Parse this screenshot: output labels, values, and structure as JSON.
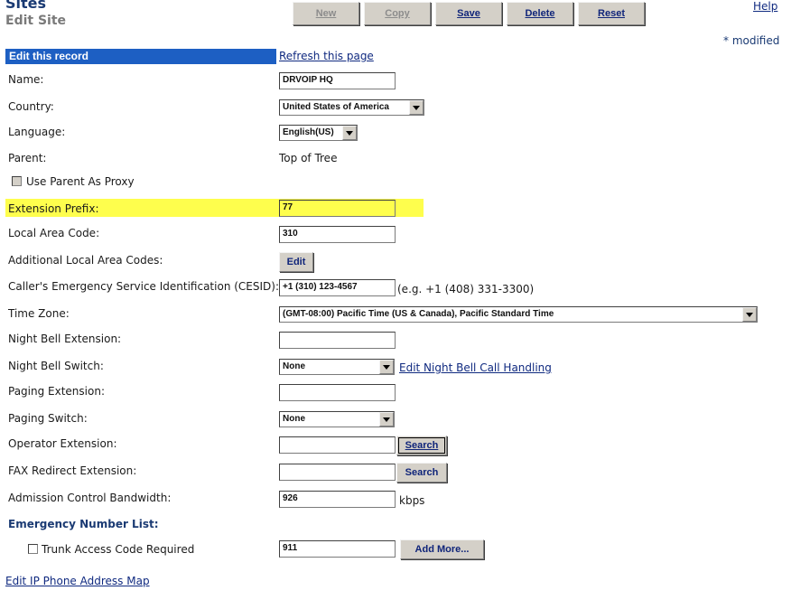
{
  "header": {
    "title": "Sites",
    "subtitle": "Edit Site",
    "help": "Help",
    "modified_note": "* modified"
  },
  "toolbar": {
    "new": "New",
    "copy": "Copy",
    "save": "Save",
    "delete": "Delete",
    "reset": "Reset"
  },
  "section": {
    "title": "Edit this record",
    "refresh": "Refresh this page"
  },
  "fields": {
    "name": {
      "label": "Name:",
      "value": "DRVOIP HQ"
    },
    "country": {
      "label": "Country:",
      "value": "United States of America"
    },
    "language": {
      "label": "Language:",
      "value": "English(US)"
    },
    "parent": {
      "label": "Parent:",
      "value": "Top of Tree"
    },
    "use_parent_proxy": {
      "label": "Use Parent As Proxy",
      "checked": false
    },
    "extension_prefix": {
      "label": "Extension Prefix:",
      "value": "77"
    },
    "local_area_code": {
      "label": "Local Area Code:",
      "value": "310"
    },
    "additional_area_codes": {
      "label": "Additional Local Area Codes:",
      "button": "Edit"
    },
    "cesid": {
      "label": "Caller's Emergency Service Identification (CESID):",
      "value": "+1 (310) 123-4567",
      "hint": "(e.g. +1 (408) 331-3300)"
    },
    "time_zone": {
      "label": "Time Zone:",
      "value": "(GMT-08:00) Pacific Time (US & Canada), Pacific Standard Time"
    },
    "night_bell_ext": {
      "label": "Night Bell Extension:",
      "value": ""
    },
    "night_bell_switch": {
      "label": "Night Bell Switch:",
      "value": "None",
      "link": "Edit Night Bell Call Handling"
    },
    "paging_ext": {
      "label": "Paging Extension:",
      "value": ""
    },
    "paging_switch": {
      "label": "Paging Switch:",
      "value": "None"
    },
    "operator_ext": {
      "label": "Operator Extension:",
      "value": "",
      "button": "Search"
    },
    "fax_redirect_ext": {
      "label": "FAX Redirect Extension:",
      "value": "",
      "button": "Search"
    },
    "admission_bw": {
      "label": "Admission Control Bandwidth:",
      "value": "926",
      "unit": "kbps"
    }
  },
  "emergency": {
    "title": "Emergency Number List:",
    "trunk_label": "Trunk Access Code Required",
    "number": "911",
    "add_more": "Add More..."
  },
  "footer_link": "Edit IP Phone Address Map",
  "colors": {
    "section_head": "#1d5fc3",
    "highlight": "#fefe4d",
    "link": "#102a80"
  }
}
